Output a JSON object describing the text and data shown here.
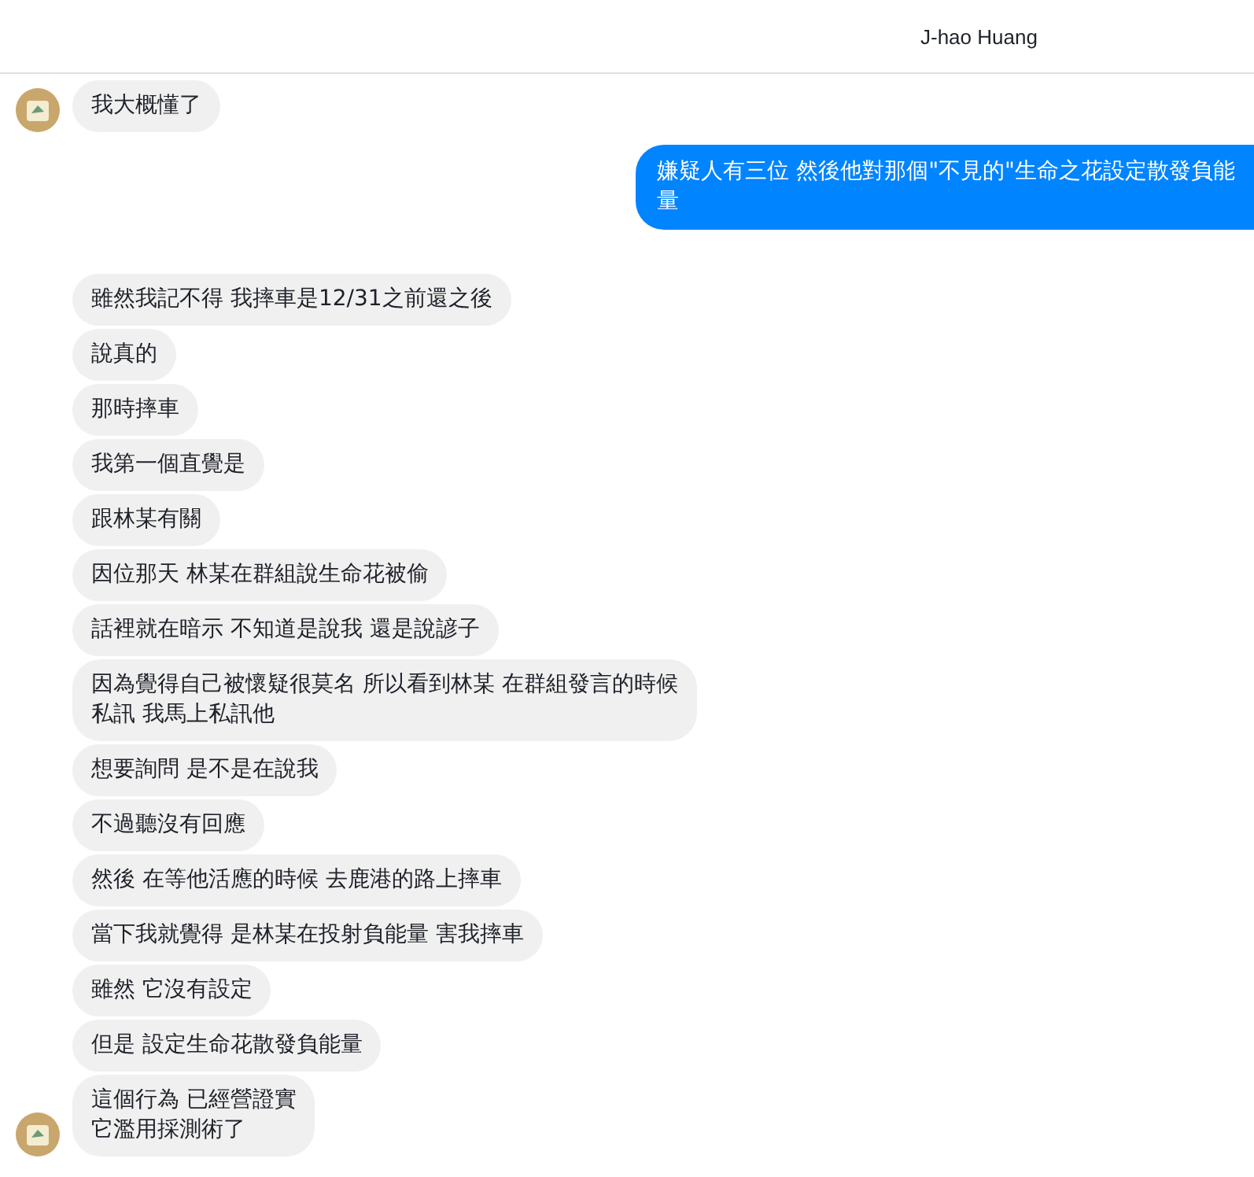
{
  "header": {
    "contact_name": "J-hao Huang"
  },
  "messages": [
    {
      "kind": "received",
      "avatar": true,
      "lines": [
        "我大概懂了"
      ]
    },
    {
      "kind": "sent",
      "lines": [
        "嫌疑人有三位 然後他對那個\"不見的\"生命之花設定散發負能",
        "量"
      ]
    },
    {
      "kind": "received",
      "avatar": false,
      "lines": [
        "雖然我記不得 我摔車是12/31之前還之後"
      ]
    },
    {
      "kind": "received",
      "avatar": false,
      "lines": [
        "說真的"
      ]
    },
    {
      "kind": "received",
      "avatar": false,
      "lines": [
        "那時摔車"
      ]
    },
    {
      "kind": "received",
      "avatar": false,
      "lines": [
        "我第一個直覺是"
      ]
    },
    {
      "kind": "received",
      "avatar": false,
      "lines": [
        "跟林某有關"
      ]
    },
    {
      "kind": "received",
      "avatar": false,
      "lines": [
        "因位那天 林某在群組說生命花被偷"
      ]
    },
    {
      "kind": "received",
      "avatar": false,
      "lines": [
        "話裡就在暗示 不知道是說我 還是說諺子"
      ]
    },
    {
      "kind": "received",
      "avatar": false,
      "lines": [
        "因為覺得自己被懷疑很莫名 所以看到林某 在群組發言的時候",
        "私訊 我馬上私訊他"
      ]
    },
    {
      "kind": "received",
      "avatar": false,
      "lines": [
        "想要詢問 是不是在說我"
      ]
    },
    {
      "kind": "received",
      "avatar": false,
      "lines": [
        "不過聽沒有回應"
      ]
    },
    {
      "kind": "received",
      "avatar": false,
      "lines": [
        "然後 在等他活應的時候 去鹿港的路上摔車"
      ]
    },
    {
      "kind": "received",
      "avatar": false,
      "lines": [
        "當下我就覺得 是林某在投射負能量 害我摔車"
      ]
    },
    {
      "kind": "received",
      "avatar": false,
      "lines": [
        "雖然 它沒有設定"
      ]
    },
    {
      "kind": "received",
      "avatar": false,
      "lines": [
        "但是 設定生命花散發負能量"
      ]
    },
    {
      "kind": "received",
      "avatar": true,
      "lines": [
        "這個行為 已經營證實",
        "它濫用採測術了"
      ]
    }
  ]
}
